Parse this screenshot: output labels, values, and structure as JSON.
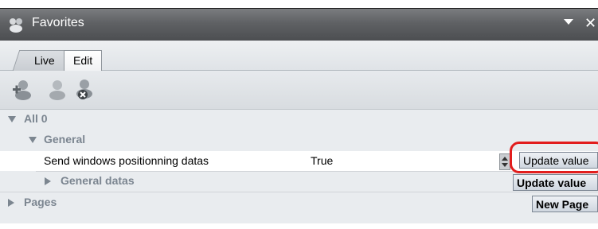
{
  "window": {
    "title": "Favorites"
  },
  "tabs": [
    {
      "label": "Live"
    },
    {
      "label": "Edit"
    }
  ],
  "toolbar": {
    "buttons": [
      {
        "icon": "add-user-icon"
      },
      {
        "icon": "user-icon"
      },
      {
        "icon": "remove-user-icon"
      }
    ]
  },
  "tree": {
    "root": {
      "label": "All 0"
    },
    "general": {
      "label": "General"
    },
    "property": {
      "name": "Send windows positionning datas",
      "value": "True"
    },
    "general_datas": {
      "label": "General datas"
    },
    "pages": {
      "label": "Pages"
    }
  },
  "buttons": {
    "update_value_1": "Update value",
    "update_value_2": "Update value",
    "new_page": "New Page"
  },
  "colors": {
    "titlebar": "#5f6164",
    "tree_label": "#7b8590",
    "highlight": "#e21d1d"
  }
}
